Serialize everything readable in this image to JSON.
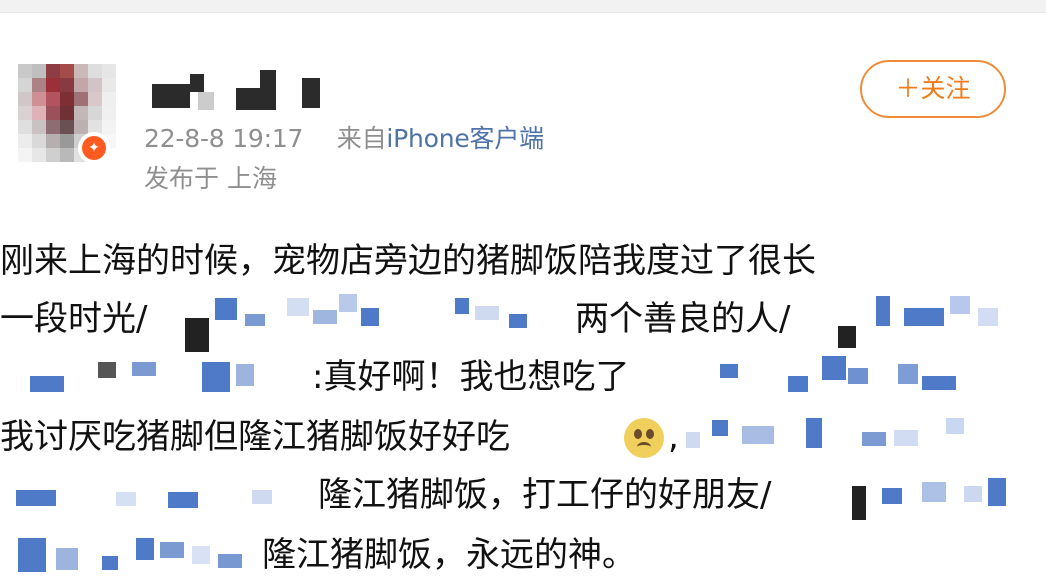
{
  "post": {
    "author_name": "",
    "timestamp": "22-8-8 19:17",
    "source_prefix": "来自",
    "source_client": "iPhone客户端",
    "location": "发布于 上海",
    "follow_label": "＋关注",
    "badge_icon": "verified-badge-icon",
    "lines": {
      "line1": "刚来上海的时候，宠物店旁边的猪脚饭陪我度过了很长",
      "line2a": "一段时光/",
      "line2b": "两个善良的人/",
      "line3": ":真好啊！我也想吃了",
      "line4": "我讨厌吃猪脚但隆江猪脚饭好好吃",
      "line4b": ",",
      "line5": "隆江猪脚饭，打工仔的好朋友/",
      "line6": "隆江猪脚饭，永远的神。"
    },
    "emoji_name": "pleading-face-icon",
    "colors": {
      "link": "#4e73a8",
      "follow": "#f07c1a",
      "mosaic_blue": "#4f7ac7",
      "meta": "#8f8f8f"
    }
  }
}
